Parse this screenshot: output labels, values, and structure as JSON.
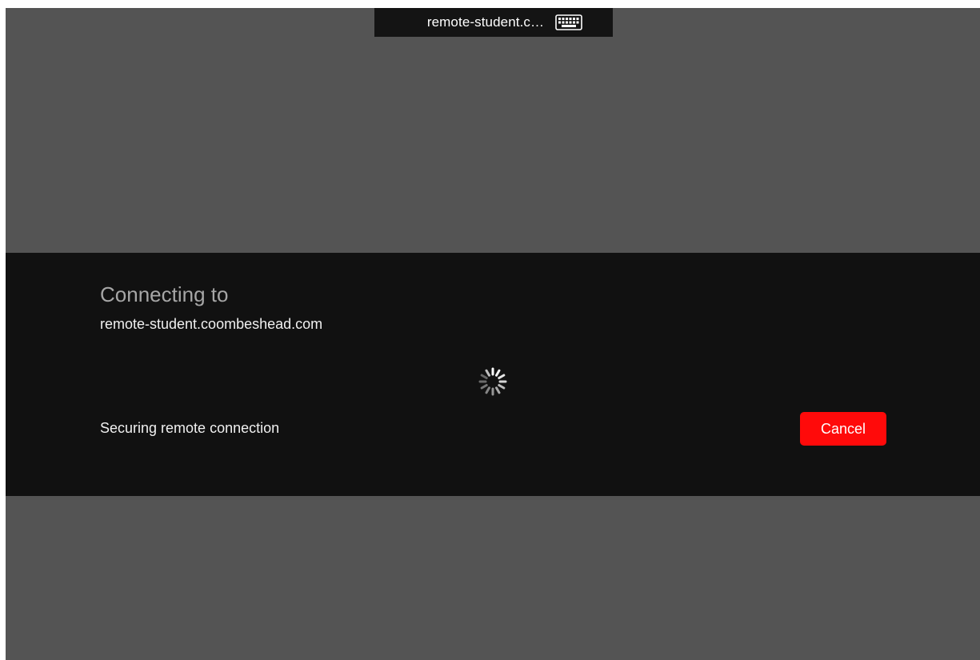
{
  "window": {
    "title": "remote-student.c…",
    "keyboard_icon": "keyboard-icon"
  },
  "dialog": {
    "heading": "Connecting to",
    "host": "remote-student.coombeshead.com",
    "spinner_icon": "loading-spinner-icon",
    "status": "Securing remote connection",
    "cancel_label": "Cancel"
  },
  "colors": {
    "background": "#545454",
    "dialog_background": "#111111",
    "topbar_background": "#141414",
    "cancel_button": "#ff0a0a",
    "heading_text": "#a6a6a6",
    "body_text": "#f0f0f0"
  }
}
